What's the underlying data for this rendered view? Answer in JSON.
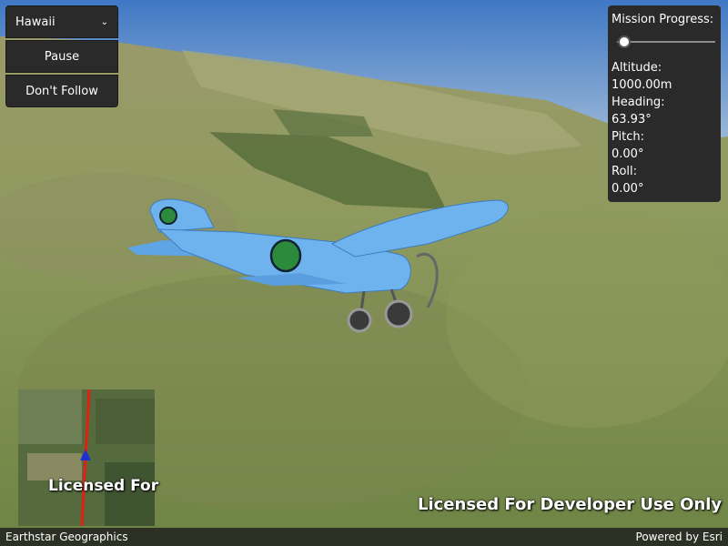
{
  "controls": {
    "location_select": "Hawaii",
    "pause_label": "Pause",
    "follow_label": "Don't Follow"
  },
  "mission": {
    "progress_label": "Mission Progress:",
    "progress_value": 0.05,
    "altitude_label": "Altitude:",
    "altitude_value": "1000.00m",
    "heading_label": "Heading:",
    "heading_value": "63.93°",
    "pitch_label": "Pitch:",
    "pitch_value": "0.00°",
    "roll_label": "Roll:",
    "roll_value": "0.00°"
  },
  "watermark": {
    "main": "Licensed For Developer Use Only",
    "minimap": "Licensed For"
  },
  "attribution": {
    "left": "Earthstar Geographics",
    "right": "Powered by Esri"
  },
  "colors": {
    "panel_bg": "#2a2a2a",
    "plane_body": "#6fb3ee",
    "route_line": "#e02010",
    "plane_marker": "#2030d0"
  }
}
